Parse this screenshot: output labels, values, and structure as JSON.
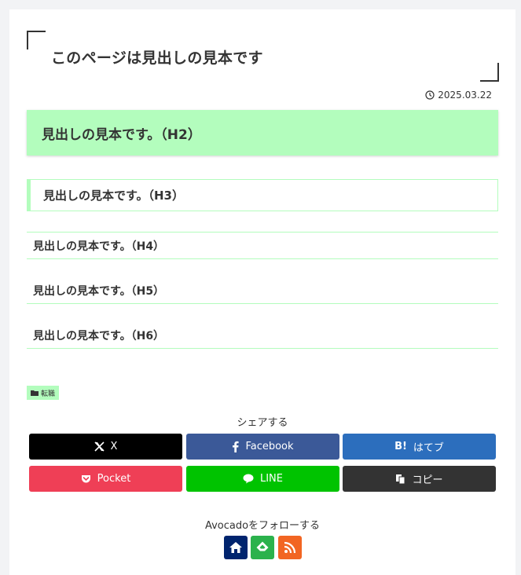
{
  "article": {
    "title": "このページは見出しの見本です",
    "date": "2025.03.22"
  },
  "headings": {
    "h2": "見出しの見本です。（H2）",
    "h3": "見出しの見本です。（H3）",
    "h4": "見出しの見本です。（H4）",
    "h5": "見出しの見本です。（H5）",
    "h6": "見出しの見本です。（H6）"
  },
  "category": {
    "label": "転職",
    "icon": "folder-icon"
  },
  "share": {
    "title": "シェアする",
    "buttons": [
      {
        "label": "X",
        "icon": "x-logo-icon",
        "color": "#000000"
      },
      {
        "label": "Facebook",
        "icon": "facebook-icon",
        "color": "#3b5998"
      },
      {
        "label": "はてブ",
        "icon": "hatena-bookmark-icon",
        "color": "#2c6ebd"
      },
      {
        "label": "Pocket",
        "icon": "pocket-icon",
        "color": "#ef3f56"
      },
      {
        "label": "LINE",
        "icon": "line-icon",
        "color": "#00c300"
      },
      {
        "label": "コピー",
        "icon": "copy-icon",
        "color": "#333333"
      }
    ]
  },
  "follow": {
    "title": "Avocadoをフォローする",
    "buttons": [
      {
        "icon": "home-icon",
        "color": "#00246e"
      },
      {
        "icon": "feedly-icon",
        "color": "#2bb24c"
      },
      {
        "icon": "rss-icon",
        "color": "#f26522"
      }
    ]
  }
}
